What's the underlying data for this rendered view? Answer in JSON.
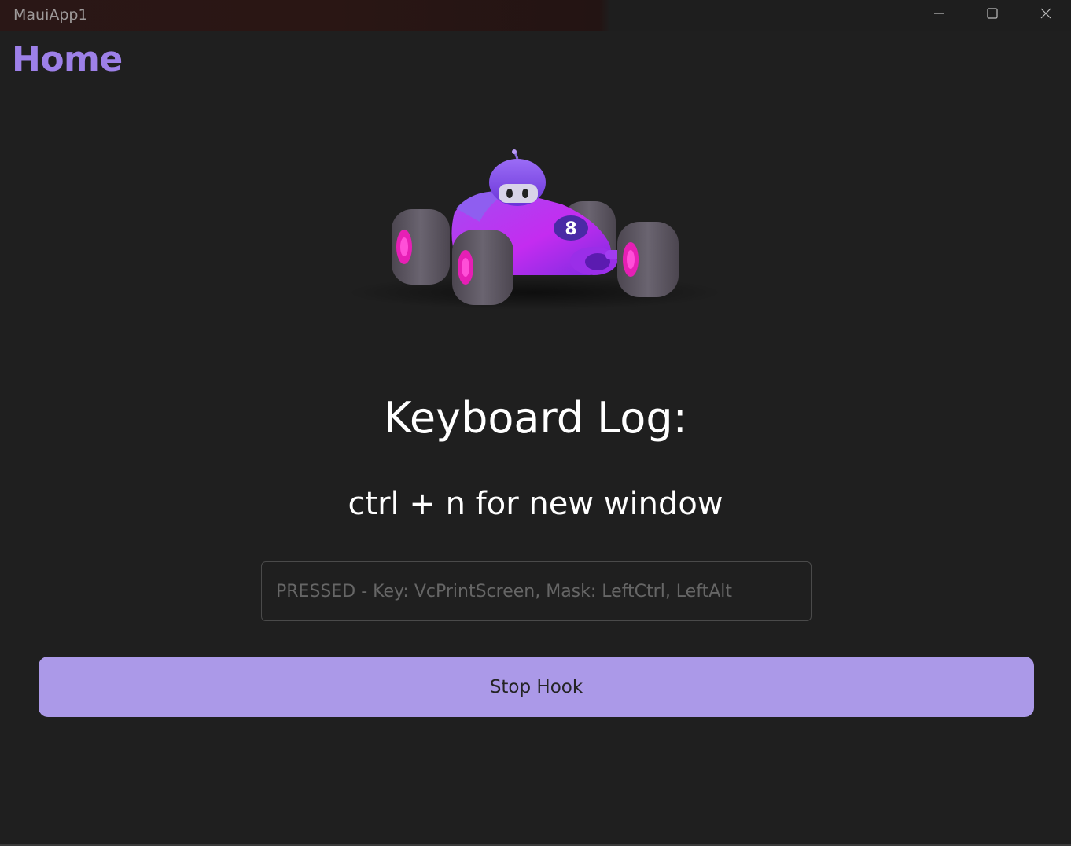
{
  "window": {
    "title": "MauiApp1"
  },
  "caption_buttons": {
    "minimize_icon": "minimize-icon",
    "maximize_icon": "maximize-icon",
    "close_icon": "close-icon"
  },
  "page": {
    "title": "Home"
  },
  "hero_image": {
    "subject": "purple race car robot with number 8"
  },
  "main": {
    "heading": "Keyboard Log:",
    "hint": "ctrl + n for new window",
    "log_field_placeholder": "PRESSED - Key: VcPrintScreen, Mask: LeftCtrl, LeftAlt",
    "stop_button_label": "Stop Hook"
  },
  "colors": {
    "accent": "#9d80e8",
    "button_bg": "#ab99e8",
    "background": "#1f1f1f"
  }
}
